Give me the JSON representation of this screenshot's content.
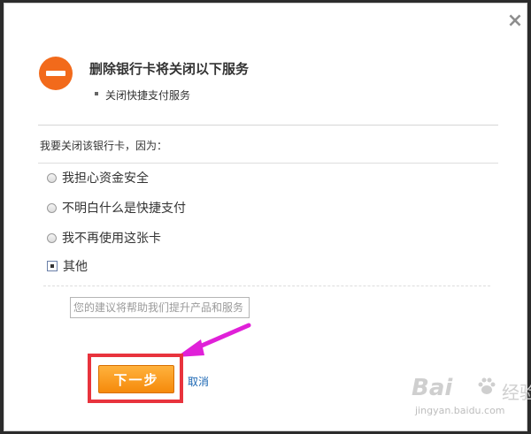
{
  "dialog": {
    "close_glyph": "×",
    "title": "删除银行卡将关闭以下服务",
    "services": [
      "关闭快捷支付服务"
    ],
    "reason_prompt": "我要关闭该银行卡，因为：",
    "options": [
      {
        "label": "我担心资金安全",
        "type": "radio",
        "checked": false
      },
      {
        "label": "不明白什么是快捷支付",
        "type": "radio",
        "checked": false
      },
      {
        "label": "我不再使用这张卡",
        "type": "radio",
        "checked": false
      },
      {
        "label": "其他",
        "type": "checkbox",
        "checked": true
      }
    ],
    "suggestion": {
      "value": "",
      "placeholder": "您的建议将帮助我们提升产品和服务"
    },
    "next_button": "下一步",
    "cancel_link": "取消"
  },
  "watermark": {
    "brand": "Bai",
    "jingyan": "经验",
    "url": "jingyan.baidu.com"
  },
  "colors": {
    "warning_icon": "#f26a1b",
    "next_button": "#f58a0b",
    "highlight": "#e8333d",
    "arrow": "#e020d8",
    "cancel_link": "#1a66b3"
  },
  "icons": {
    "warning": "minus-circle-icon",
    "close": "close-icon"
  }
}
